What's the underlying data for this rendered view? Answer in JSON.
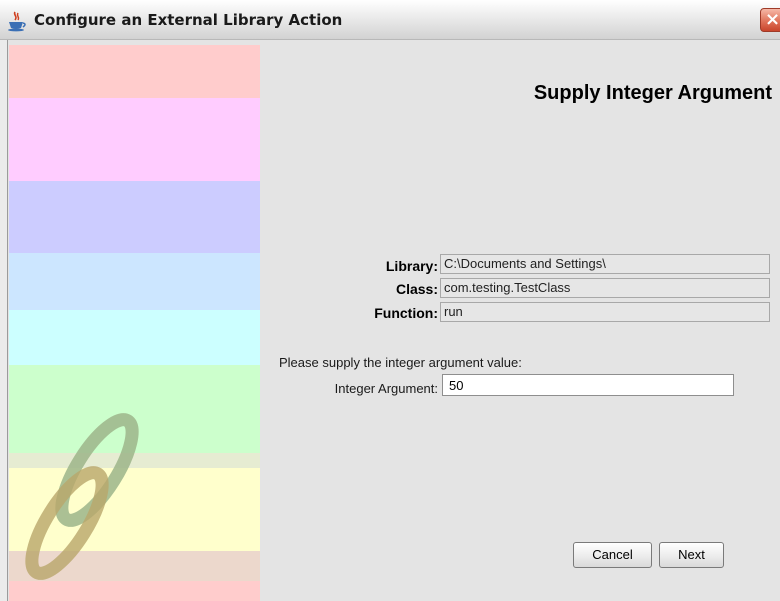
{
  "window": {
    "title": "Configure an External Library Action",
    "close_glyph": "×",
    "icon": "java-coffee-cup-icon"
  },
  "sidebar": {
    "stripe_colors": [
      "#ffcccc",
      "#ffccff",
      "#ccccff",
      "#cce6ff",
      "#ccffff",
      "#ccffcc",
      "#ffffcc"
    ],
    "logo": "infinity-rings-logo"
  },
  "main": {
    "heading": "Supply Integer Argument",
    "info": {
      "library_label": "Library:",
      "library_value": "C:\\Documents and Settings\\",
      "class_label": "Class:",
      "class_value": "com.testing.TestClass",
      "function_label": "Function:",
      "function_value": "run"
    },
    "prompt": "Please supply the integer argument value:",
    "integer_label": "Integer Argument:",
    "integer_value": "50"
  },
  "buttons": {
    "cancel": "Cancel",
    "next": "Next"
  }
}
